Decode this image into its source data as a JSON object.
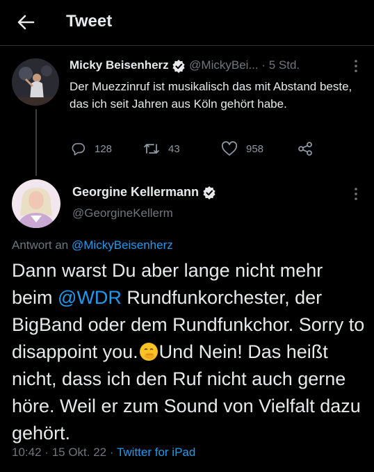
{
  "header": {
    "title": "Tweet"
  },
  "reply_tweet": {
    "author_name": "Micky Beisenherz",
    "handle": "@MickyBei...",
    "separator": "·",
    "time": "5 Std.",
    "text": "Der Muezzinruf ist musikalisch das mit Abstand beste, das ich seit Jahren aus Köln gehört habe.",
    "stats": {
      "replies": "128",
      "retweets": "43",
      "likes": "958"
    }
  },
  "main_tweet": {
    "author_name": "Georgine Kellermann",
    "handle": "@GeorgineKellerm",
    "replying_label": "Antwort an",
    "replying_handle": "@MickyBeisenherz",
    "text_part1": "Dann warst Du aber lange nicht mehr beim ",
    "mention": "@WDR",
    "text_part2": " Rundfunkorchester, der BigBand oder dem Rundfunkchor. Sorry to disappoint you.",
    "text_part3": "Und Nein! Das heißt nicht, dass ich den Ruf nicht auch gerne höre. Weil er zum Sound von Vielfalt dazu gehört.",
    "time": "10:42",
    "separator1": "·",
    "date": "15 Okt. 22",
    "separator2": "·",
    "source": "Twitter for iPad"
  },
  "icons": {
    "back": "arrow-left-icon",
    "verified": "verified-badge-icon",
    "more": "more-vertical-icon",
    "reply": "reply-icon",
    "retweet": "retweet-icon",
    "like": "heart-icon",
    "share": "share-icon",
    "emoji": "face-with-hand-over-mouth-emoji"
  },
  "colors": {
    "background": "#000000",
    "text": "#e7e9ea",
    "muted": "#71767b",
    "accent": "#1d9bf0"
  }
}
